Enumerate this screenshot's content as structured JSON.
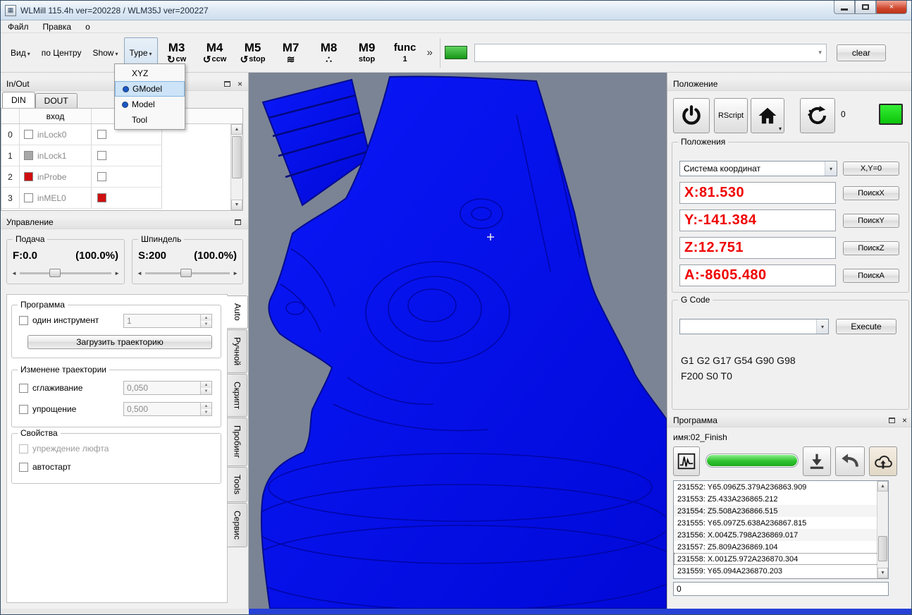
{
  "window": {
    "title": "WLMill 115.4h ver=200228 / WLM35J ver=200227"
  },
  "menubar": {
    "items": [
      "Файл",
      "Правка",
      "о"
    ]
  },
  "toolbar": {
    "view": "Вид",
    "center": "по Центру",
    "show": "Show",
    "type": "Type",
    "m_buttons": [
      {
        "label": "M3",
        "sub": "cw",
        "icon": "cw-arrow"
      },
      {
        "label": "M4",
        "sub": "ccw",
        "icon": "ccw-arrow"
      },
      {
        "label": "M5",
        "sub": "stop",
        "icon": "ccw-arrow"
      },
      {
        "label": "M7",
        "sub": "",
        "icon": "air-blast"
      },
      {
        "label": "M8",
        "sub": "",
        "icon": "coolant-drops"
      },
      {
        "label": "M9",
        "sub": "stop",
        "icon": "stop"
      },
      {
        "label": "func",
        "sub": "1",
        "icon": "none"
      }
    ],
    "overflow": "»",
    "clear": "clear",
    "combo_value": ""
  },
  "type_menu": {
    "items": [
      {
        "label": "XYZ",
        "radio": false,
        "selected": false
      },
      {
        "label": "GModel",
        "radio": true,
        "selected": true
      },
      {
        "label": "Model",
        "radio": true,
        "selected": false
      },
      {
        "label": "Tool",
        "radio": false,
        "selected": false
      }
    ]
  },
  "inout": {
    "title": "In/Out",
    "tabs": [
      "DIN",
      "DOUT"
    ],
    "header": "вход",
    "rows": [
      {
        "num": "0",
        "label": "inLock0",
        "state1": "off",
        "state2": "off"
      },
      {
        "num": "1",
        "label": "inLock1",
        "state1": "disabled",
        "state2": "off"
      },
      {
        "num": "2",
        "label": "inProbe",
        "state1": "on",
        "state2": "off"
      },
      {
        "num": "3",
        "label": "inMEL0",
        "state1": "off",
        "state2": "on"
      }
    ]
  },
  "control": {
    "title": "Управление",
    "feed": {
      "group": "Подача",
      "value": "F:0.0",
      "percent": "(100.0%)"
    },
    "spindle": {
      "group": "Шпиндель",
      "value": "S:200",
      "percent": "(100.0%)"
    }
  },
  "auto_tab": {
    "program_group": "Программа",
    "single_tool": "один инструмент",
    "single_tool_value": "1",
    "load_button": "Загрузить траекторию",
    "modify_group": "Изменене траектории",
    "smooth_label": "сглаживание",
    "smooth_value": "0,050",
    "simplify_label": "упрощение",
    "simplify_value": "0,500",
    "props_group": "Свойства",
    "backlash_label": "упреждение люфта",
    "autostart_label": "автостарт"
  },
  "side_tabs": [
    "Auto",
    "Ручной",
    "Скрипт",
    "Пробинг",
    "Tools",
    "Сервис"
  ],
  "position": {
    "title": "Положение",
    "rscript": "RScript",
    "counter": "0",
    "group": "Положения",
    "coord_system": "Система координат",
    "xy_zero": "X,Y=0",
    "coords": [
      {
        "value": "X:81.530",
        "search": "ПоискX"
      },
      {
        "value": "Y:-141.384",
        "search": "ПоискY"
      },
      {
        "value": "Z:12.751",
        "search": "ПоискZ"
      },
      {
        "value": "A:-8605.480",
        "search": "ПоискA"
      }
    ],
    "gcode_group": "G Code",
    "gcode_combo_value": "",
    "execute": "Execute",
    "modal1": "G1 G2 G17 G54 G90 G98",
    "modal2": "F200 S0 T0"
  },
  "program": {
    "title": "Программа",
    "name": "имя:02_Finish",
    "lines": [
      "231552: Y65.096Z5.379A236863.909",
      "231553: Z5.433A236865.212",
      "231554: Z5.508A236866.515",
      "231555: Y65.097Z5.638A236867.815",
      "231556: X.004Z5.798A236869.017",
      "231557: Z5.809A236869.104",
      "231558: X.001Z5.972A236870.304",
      "231559: Y65.094A236870.203"
    ],
    "selected_line": "231558: X.001Z5.972A236870.304",
    "input_value": "0"
  },
  "icons": {
    "dropdown": "▾",
    "overflow": "»",
    "up": "▲",
    "down": "▼",
    "left": "◄",
    "right": "►",
    "close": "×",
    "cw": "↻",
    "ccw": "↺",
    "air": "≋",
    "drops": "∴"
  },
  "colors": {
    "viewport_bg": "#7b8494",
    "model_blue": "#0a16f5",
    "coord_red": "#ef0000",
    "status_green": "#17961f",
    "progress_green": "#2ec22e",
    "statusbar_blue": "#2742d6"
  }
}
